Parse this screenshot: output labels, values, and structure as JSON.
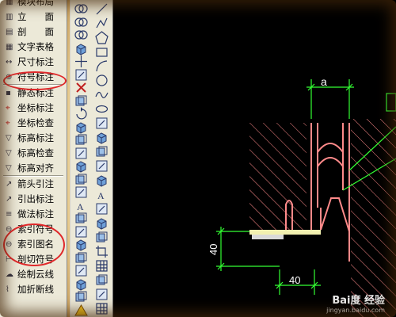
{
  "menu": {
    "items": [
      {
        "label": "模块布局",
        "icon": "layout-icon",
        "clickable": true
      },
      {
        "label": "立　　面",
        "icon": "elevation-icon",
        "clickable": true
      },
      {
        "label": "剖　　面",
        "icon": "section-icon",
        "clickable": true
      },
      {
        "label": "文字表格",
        "icon": "text-table-icon",
        "clickable": true
      },
      {
        "label": "尺寸标注",
        "icon": "dimension-icon",
        "clickable": true
      },
      {
        "label": "符号标注",
        "icon": "symbol-icon",
        "clickable": true
      },
      {
        "label": "静态标注",
        "icon": "static-annotation-icon",
        "clickable": true
      },
      {
        "label": "坐标标注",
        "icon": "coordinate-annotation-icon",
        "clickable": true
      },
      {
        "label": "坐标检查",
        "icon": "coordinate-check-icon",
        "clickable": true
      },
      {
        "label": "标高标注",
        "icon": "elevation-mark-icon",
        "clickable": true
      },
      {
        "label": "标高检查",
        "icon": "elevation-check-icon",
        "clickable": true
      },
      {
        "label": "标高对齐",
        "icon": "elevation-align-icon",
        "clickable": true
      },
      {
        "label": "箭头引注",
        "icon": "arrow-leader-icon",
        "clickable": true
      },
      {
        "label": "引出标注",
        "icon": "leader-annotation-icon",
        "clickable": true
      },
      {
        "label": "做法标注",
        "icon": "method-annotation-icon",
        "clickable": true
      },
      {
        "label": "索引符号",
        "icon": "index-symbol-icon",
        "clickable": true
      },
      {
        "label": "索引图名",
        "icon": "index-title-icon",
        "clickable": true
      },
      {
        "label": "剖切符号",
        "icon": "section-cut-icon",
        "clickable": true
      },
      {
        "label": "绘制云线",
        "icon": "revision-cloud-icon",
        "clickable": true
      },
      {
        "label": "加折断线",
        "icon": "break-line-icon",
        "clickable": true
      }
    ]
  },
  "toolbar_left": {
    "icons": [
      "dual-circle-icon",
      "dual-circle-icon",
      "dual-circle-icon",
      "layer-icon",
      "move-icon",
      "copy-icon",
      "erase-icon",
      "copy-cube-icon",
      "rotate-icon",
      "box-icon",
      "stack-icon",
      "stretch-icon",
      "cube-icon",
      "cube-icon",
      "cube-icon",
      "text-icon",
      "trim-icon",
      "fillet-icon",
      "box-icon",
      "cube-icon",
      "box-icon",
      "cube-icon",
      "scale-icon",
      "warning-icon"
    ]
  },
  "toolbar_right": {
    "icons": [
      "line-icon",
      "polyline-icon",
      "pentagon-icon",
      "rectangle-icon",
      "arc-icon",
      "circle-icon",
      "spline-icon",
      "ellipse-icon",
      "block-icon",
      "insert-icon",
      "point-icon",
      "hatch-icon",
      "region-icon",
      "text-icon",
      "dim-icon",
      "cube-icon",
      "cube-icon",
      "crop-icon",
      "grid-icon",
      "dim-icon",
      "shape-icon",
      "table-icon"
    ]
  },
  "drawing": {
    "dim_top": "a",
    "dim_left": "40",
    "dim_bottom": "40",
    "colors": {
      "line": "#ff8a8a",
      "dim": "#33ff33",
      "hatch": "#ff8a8a",
      "highlight": "#e0282a"
    }
  },
  "watermark": {
    "line1": "Bai度 经验",
    "line2": "jingyan.baidu.com"
  }
}
